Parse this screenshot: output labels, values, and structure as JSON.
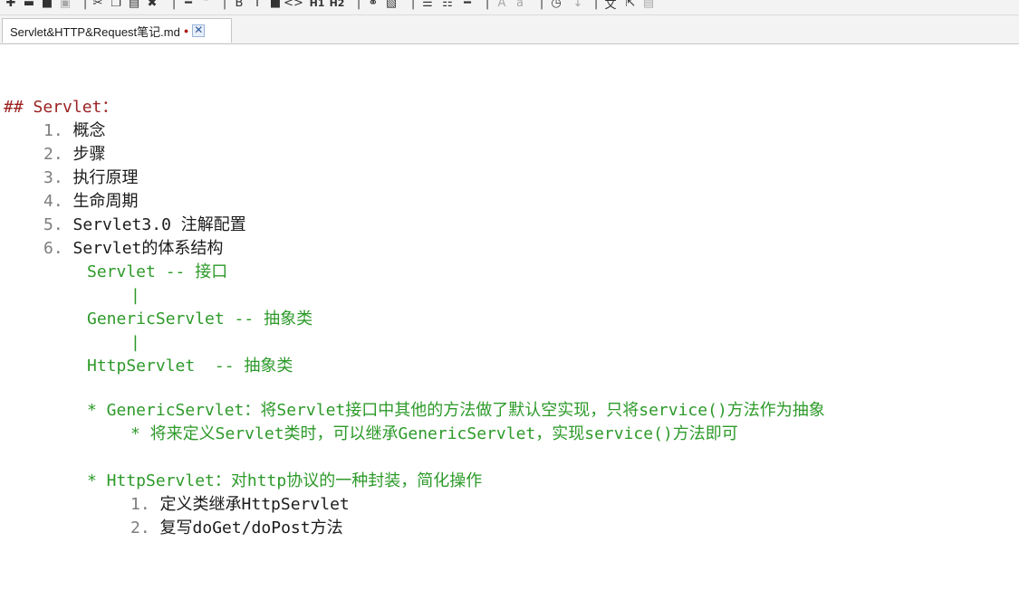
{
  "toolbar": {
    "buttons": [
      {
        "icon": "new-file-icon"
      },
      {
        "icon": "open-folder-icon"
      },
      {
        "icon": "save-icon"
      },
      {
        "icon": "save-all-icon"
      },
      {
        "icon": "cut-icon"
      },
      {
        "icon": "copy-icon"
      },
      {
        "icon": "paste-icon"
      },
      {
        "icon": "delete-icon"
      },
      {
        "icon": "horizontal-rule-icon"
      },
      {
        "icon": "bold-icon"
      },
      {
        "icon": "italic-icon"
      },
      {
        "icon": "quote-icon"
      },
      {
        "icon": "code-icon"
      },
      {
        "icon": "heading1-icon"
      },
      {
        "icon": "heading2-icon"
      },
      {
        "icon": "link-icon"
      },
      {
        "icon": "image-icon"
      },
      {
        "icon": "unordered-list-icon"
      },
      {
        "icon": "ordered-list-icon"
      },
      {
        "icon": "separator-icon"
      },
      {
        "icon": "font-increase-icon"
      },
      {
        "icon": "font-decrease-icon"
      },
      {
        "icon": "history-icon"
      },
      {
        "icon": "arrow-down-icon"
      },
      {
        "icon": "translate-icon"
      },
      {
        "icon": "export-icon"
      },
      {
        "icon": "preview-icon"
      }
    ],
    "heading1_label": "H1",
    "heading2_label": "H2"
  },
  "tab": {
    "title": "Servlet&HTTP&Request笔记.md",
    "modified_marker": "●",
    "close_symbol": "✕"
  },
  "editor": {
    "heading": "## Servlet：",
    "items": [
      {
        "num": "1.",
        "text": "概念"
      },
      {
        "num": "2.",
        "text": "步骤"
      },
      {
        "num": "3.",
        "text": "执行原理"
      },
      {
        "num": "4.",
        "text": "生命周期"
      },
      {
        "num": "5.",
        "text": "Servlet3.0 注解配置"
      },
      {
        "num": "6.",
        "text": "Servlet的体系结构"
      }
    ],
    "hierarchy": [
      "Servlet -- 接口",
      "|",
      "GenericServlet -- 抽象类",
      "|",
      "HttpServlet  -- 抽象类"
    ],
    "generic_note": "* GenericServlet：将Servlet接口中其他的方法做了默认空实现，只将service()方法作为抽象",
    "generic_sub_note": "* 将来定义Servlet类时，可以继承GenericServlet，实现service()方法即可",
    "http_note": "* HttpServlet：对http协议的一种封装，简化操作",
    "http_steps": [
      {
        "num": "1.",
        "text": "定义类继承HttpServlet"
      },
      {
        "num": "2.",
        "text": "复写doGet/doPost方法"
      }
    ]
  }
}
